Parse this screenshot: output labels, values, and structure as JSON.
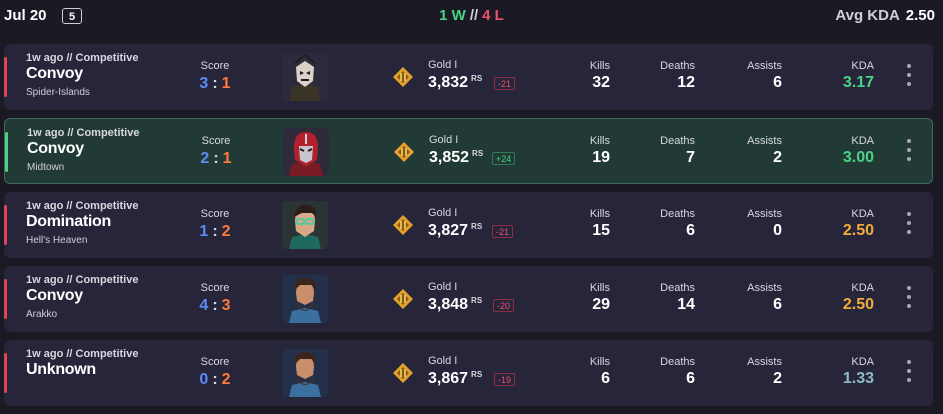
{
  "header": {
    "date": "Jul 20",
    "match_count": "5",
    "wins": "1 W",
    "separator": "//",
    "losses": "4 L",
    "avg_kda_label": "Avg KDA",
    "avg_kda_value": "2.50"
  },
  "labels": {
    "score": "Score",
    "kills": "Kills",
    "deaths": "Deaths",
    "assists": "Assists",
    "kda": "KDA",
    "rs_unit": "RS",
    "colon": ":"
  },
  "matches": [
    {
      "meta": "1w ago // Competitive",
      "mode": "Convoy",
      "map": "Spider-Islands",
      "score_a": "3",
      "score_b": "1",
      "rank": "Gold I",
      "rs": "3,832",
      "rs_delta": "-21",
      "kills": "32",
      "deaths": "12",
      "assists": "6",
      "kda": "3.17",
      "result": "loss",
      "kda_color": "green"
    },
    {
      "meta": "1w ago // Competitive",
      "mode": "Convoy",
      "map": "Midtown",
      "score_a": "2",
      "score_b": "1",
      "rank": "Gold I",
      "rs": "3,852",
      "rs_delta": "+24",
      "kills": "19",
      "deaths": "7",
      "assists": "2",
      "kda": "3.00",
      "result": "win",
      "kda_color": "green"
    },
    {
      "meta": "1w ago // Competitive",
      "mode": "Domination",
      "map": "Hell's Heaven",
      "score_a": "1",
      "score_b": "2",
      "rank": "Gold I",
      "rs": "3,827",
      "rs_delta": "-21",
      "kills": "15",
      "deaths": "6",
      "assists": "0",
      "kda": "2.50",
      "result": "loss",
      "kda_color": "orange"
    },
    {
      "meta": "1w ago // Competitive",
      "mode": "Convoy",
      "map": "Arakko",
      "score_a": "4",
      "score_b": "3",
      "rank": "Gold I",
      "rs": "3,848",
      "rs_delta": "-20",
      "kills": "29",
      "deaths": "14",
      "assists": "6",
      "kda": "2.50",
      "result": "loss",
      "kda_color": "orange"
    },
    {
      "meta": "1w ago // Competitive",
      "mode": "Unknown",
      "map": "",
      "score_a": "0",
      "score_b": "2",
      "rank": "Gold I",
      "rs": "3,867",
      "rs_delta": "-19",
      "kills": "6",
      "deaths": "6",
      "assists": "2",
      "kda": "1.33",
      "result": "loss",
      "kda_color": "blue"
    }
  ],
  "icons": {
    "avatar": "hero-portrait-icon",
    "rank": "gold-rank-icon",
    "more": "more-options-icon"
  },
  "colors": {
    "win": "#4ad385",
    "loss": "#f0516a",
    "team_a": "#5b8df5",
    "team_b": "#ff7a3c",
    "kda_green": "#4ad385",
    "kda_orange": "#f3ab3a",
    "kda_blue": "#8fb9c8"
  }
}
